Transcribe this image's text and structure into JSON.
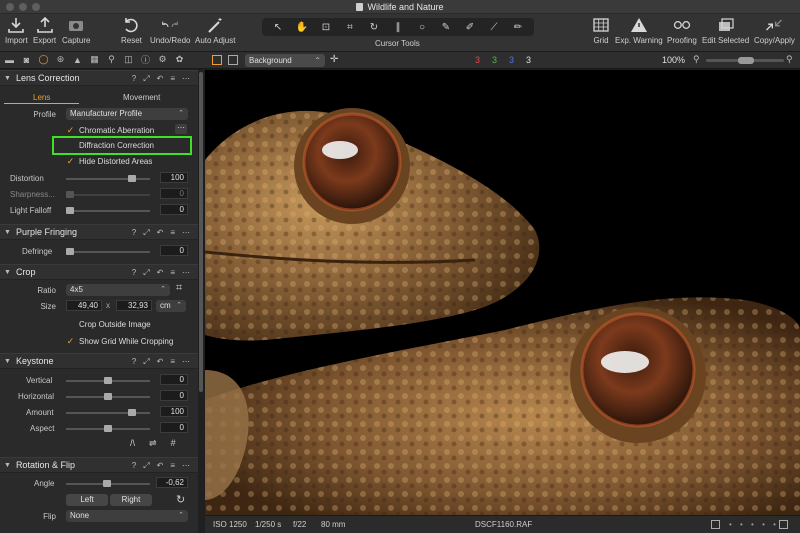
{
  "window": {
    "title": "Wildlife and Nature"
  },
  "toolbar": {
    "import": "Import",
    "export": "Export",
    "capture": "Capture",
    "reset": "Reset",
    "undo_redo": "Undo/Redo",
    "auto_adjust": "Auto Adjust",
    "cursor_tools": "Cursor Tools",
    "grid": "Grid",
    "exp_warning": "Exp. Warning",
    "proofing": "Proofing",
    "edit_selected": "Edit Selected",
    "copy_apply": "Copy/Apply"
  },
  "subbar": {
    "background_select": "Background",
    "channels": [
      {
        "label": "3",
        "color": "#e04848"
      },
      {
        "label": "3",
        "color": "#40c040"
      },
      {
        "label": "3",
        "color": "#4a7ae0"
      },
      {
        "label": "3",
        "color": "#e0e0e0"
      }
    ],
    "zoom": "100%"
  },
  "lens": {
    "title": "Lens Correction",
    "tab_lens": "Lens",
    "tab_movement": "Movement",
    "profile_label": "Profile",
    "profile_value": "Manufacturer Profile",
    "chromatic": "Chromatic Aberration",
    "diffraction": "Diffraction Correction",
    "hide_distorted": "Hide Distorted Areas",
    "distortion_label": "Distortion",
    "distortion_value": "100",
    "distortion_level": 1.0,
    "sharpness_label": "Sharpness...",
    "sharpness_value": "0",
    "light_falloff_label": "Light Falloff",
    "light_falloff_value": "0"
  },
  "purple": {
    "title": "Purple Fringing",
    "defringe_label": "Defringe",
    "defringe_value": "0"
  },
  "crop": {
    "title": "Crop",
    "ratio_label": "Ratio",
    "ratio_value": "4x5",
    "size_label": "Size",
    "width": "49,40",
    "x": "x",
    "height": "32,93",
    "unit": "cm",
    "outside": "Crop Outside Image",
    "show_grid": "Show Grid While Cropping"
  },
  "keystone": {
    "title": "Keystone",
    "vertical_label": "Vertical",
    "vertical_value": "0",
    "horizontal_label": "Horizontal",
    "horizontal_value": "0",
    "amount_label": "Amount",
    "amount_value": "100",
    "aspect_label": "Aspect",
    "aspect_value": "0"
  },
  "rotation": {
    "title": "Rotation & Flip",
    "angle_label": "Angle",
    "angle_value": "-0,62",
    "left": "Left",
    "right": "Right",
    "flip_label": "Flip",
    "flip_value": "None"
  },
  "status": {
    "iso": "ISO 1250",
    "shutter": "1/250 s",
    "aperture": "f/22",
    "focal": "80 mm",
    "filename": "DSCF1160.RAF"
  },
  "colors": {
    "accent": "#f0a030",
    "highlight_box": "#3ee02a"
  }
}
